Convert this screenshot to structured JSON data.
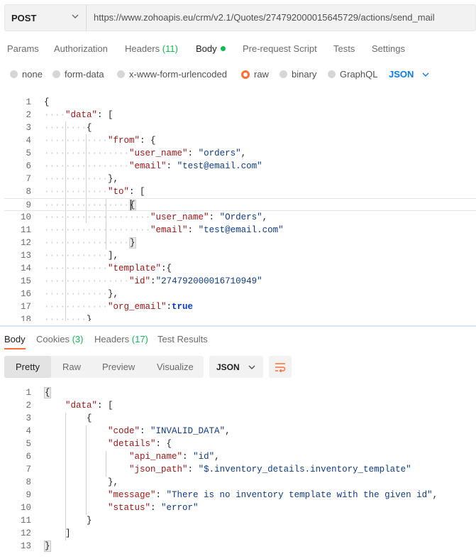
{
  "request": {
    "method": "POST",
    "url": "https://www.zohoapis.eu/crm/v2.1/Quotes/274792000015645729/actions/send_mail"
  },
  "request_tabs": {
    "params": "Params",
    "authorization": "Authorization",
    "headers": "Headers",
    "headers_count": "(11)",
    "body": "Body",
    "pre_request": "Pre-request Script",
    "tests": "Tests",
    "settings": "Settings"
  },
  "body_types": {
    "none": "none",
    "form_data": "form-data",
    "urlencoded": "x-www-form-urlencoded",
    "raw": "raw",
    "binary": "binary",
    "graphql": "GraphQL",
    "format": "JSON",
    "selected": "raw"
  },
  "editor": {
    "line_numbers": [
      "1",
      "2",
      "3",
      "4",
      "5",
      "6",
      "7",
      "8",
      "9",
      "10",
      "11",
      "12",
      "13",
      "14",
      "15",
      "16",
      "17",
      "18"
    ],
    "text": {
      "l1": "{",
      "l2k": "\"data\"",
      "l2p": ": [",
      "l3": "{",
      "l4k": "\"from\"",
      "l4p": ": {",
      "l5k": "\"user_name\"",
      "l5s": "\"orders\"",
      "l6k": "\"email\"",
      "l6s": "\"test@email.com\"",
      "l7": "},",
      "l8k": "\"to\"",
      "l8p": ": [",
      "l9": "{",
      "l10k": "\"user_name\"",
      "l10s": "\"Orders\"",
      "l11k": "\"email\"",
      "l11s": "\"test@email.com\"",
      "l12": "}",
      "l13": "],",
      "l14k": "\"template\"",
      "l14p": ":{",
      "l15k": "\"id\"",
      "l15s": "\"274792000016710949\"",
      "l16": "},",
      "l17k": "\"org_email\"",
      "l17b": "true",
      "l18": "}"
    }
  },
  "response_tabs": {
    "body": "Body",
    "cookies": "Cookies",
    "cookies_count": "(3)",
    "headers": "Headers",
    "headers_count": "(17)",
    "test_results": "Test Results"
  },
  "view_modes": {
    "pretty": "Pretty",
    "raw": "Raw",
    "preview": "Preview",
    "visualize": "Visualize",
    "format": "JSON"
  },
  "response": {
    "line_numbers": [
      "1",
      "2",
      "3",
      "4",
      "5",
      "6",
      "7",
      "8",
      "9",
      "10",
      "11",
      "12",
      "13"
    ],
    "text": {
      "l1": "{",
      "l2k": "\"data\"",
      "l2p": ": [",
      "l3": "{",
      "l4k": "\"code\"",
      "l4s": "\"INVALID_DATA\"",
      "l5k": "\"details\"",
      "l5p": ": {",
      "l6k": "\"api_name\"",
      "l6s": "\"id\"",
      "l7k": "\"json_path\"",
      "l7s": "\"$.inventory_details.inventory_template\"",
      "l8": "},",
      "l9k": "\"message\"",
      "l9s": "\"There is no inventory template with the given id\"",
      "l10k": "\"status\"",
      "l10s": "\"error\"",
      "l11": "}",
      "l12": "]",
      "l13": "}"
    }
  },
  "colors": {
    "accent": "#ff6c37",
    "success": "#0cbb52",
    "link": "#097bed"
  }
}
